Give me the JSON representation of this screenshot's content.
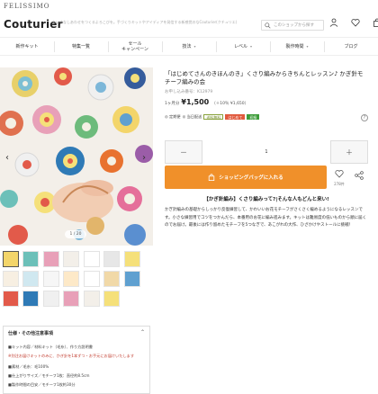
{
  "topbar": {
    "brand": "FELISSIMO"
  },
  "header": {
    "logo": "Couturier",
    "tagline": "ちいさなしあわせをつくるよろこびを。手づくりキットやアイディアを発信する新感覚のなCouturier(クチュリエ)",
    "search_placeholder": "このショップから探す"
  },
  "nav": [
    {
      "label": "新作キット",
      "has_chevron": false
    },
    {
      "label": "特集一覧",
      "has_chevron": false
    },
    {
      "label": "セール\nキャンペーン",
      "has_chevron": false
    },
    {
      "label": "技法",
      "has_chevron": true
    },
    {
      "label": "レベル",
      "has_chevron": true
    },
    {
      "label": "製作時間",
      "has_chevron": true
    },
    {
      "label": "ブログ",
      "has_chevron": false
    }
  ],
  "gallery": {
    "page_indicator": "1 / 20",
    "thumbnail_count": 20
  },
  "product": {
    "title": "「はじめてさんのきほんのき」くさり編みからきちんとレッスン♪ かぎ針モチーフ編みの会",
    "number": "お申し込み番号：K12979",
    "price_label": "1ヶ月分",
    "price": "¥1,500",
    "price_note": "（＋10％ ¥1,650）",
    "tags": [
      {
        "text": "定期便",
        "style": "plain"
      },
      {
        "text": "当日配送",
        "style": "plain"
      },
      {
        "text": "送料無料",
        "style": "box"
      },
      {
        "text": "はじめて",
        "style": "red"
      },
      {
        "text": "初級",
        "style": "green"
      }
    ],
    "help_icon": "?"
  },
  "purchase": {
    "minus": "－",
    "qty": "1",
    "plus": "＋",
    "cart_label": "ショッピングバッグに入れる",
    "fav_count": "278件"
  },
  "description": {
    "heading": "【かぎ針編み】くさり編みって?|そんな人もどんと来い!",
    "body": "かぎ針編みの基礎からしっかり反復練習して、かわいいお花モチーフがさくさく編めるようになるレッスンです。小さな練習用でコツをつかんだら、本番用のお花に編み進みます。キットは難易度の低いものから順に届くのでお届け。最後には作り留めたモチーフを5つなぎで、あこがれの大作、ひざかけやストールに挑戦！"
  },
  "info": {
    "title": "仕様・その他注意事項",
    "lines": [
      {
        "text": "■キット内容／材料キット（毛糸）、作り方説明書",
        "red": false
      },
      {
        "text": "※別注お届けキットのみに、かぎ針を1本ずつ・お手元にお届けいたします",
        "red": true
      },
      {
        "text": "■素材／毛糸：毛100%",
        "red": false
      },
      {
        "text": "■仕上がりサイズ／モチーフ1枚：直径約8.5cm",
        "red": false
      },
      {
        "text": "■製作時間の目安／モチーフ1枚約30分",
        "red": false
      }
    ]
  },
  "colors": {
    "accent": "#f0902a",
    "tag_red": "#e15a3e",
    "tag_green": "#3e9d3b"
  }
}
